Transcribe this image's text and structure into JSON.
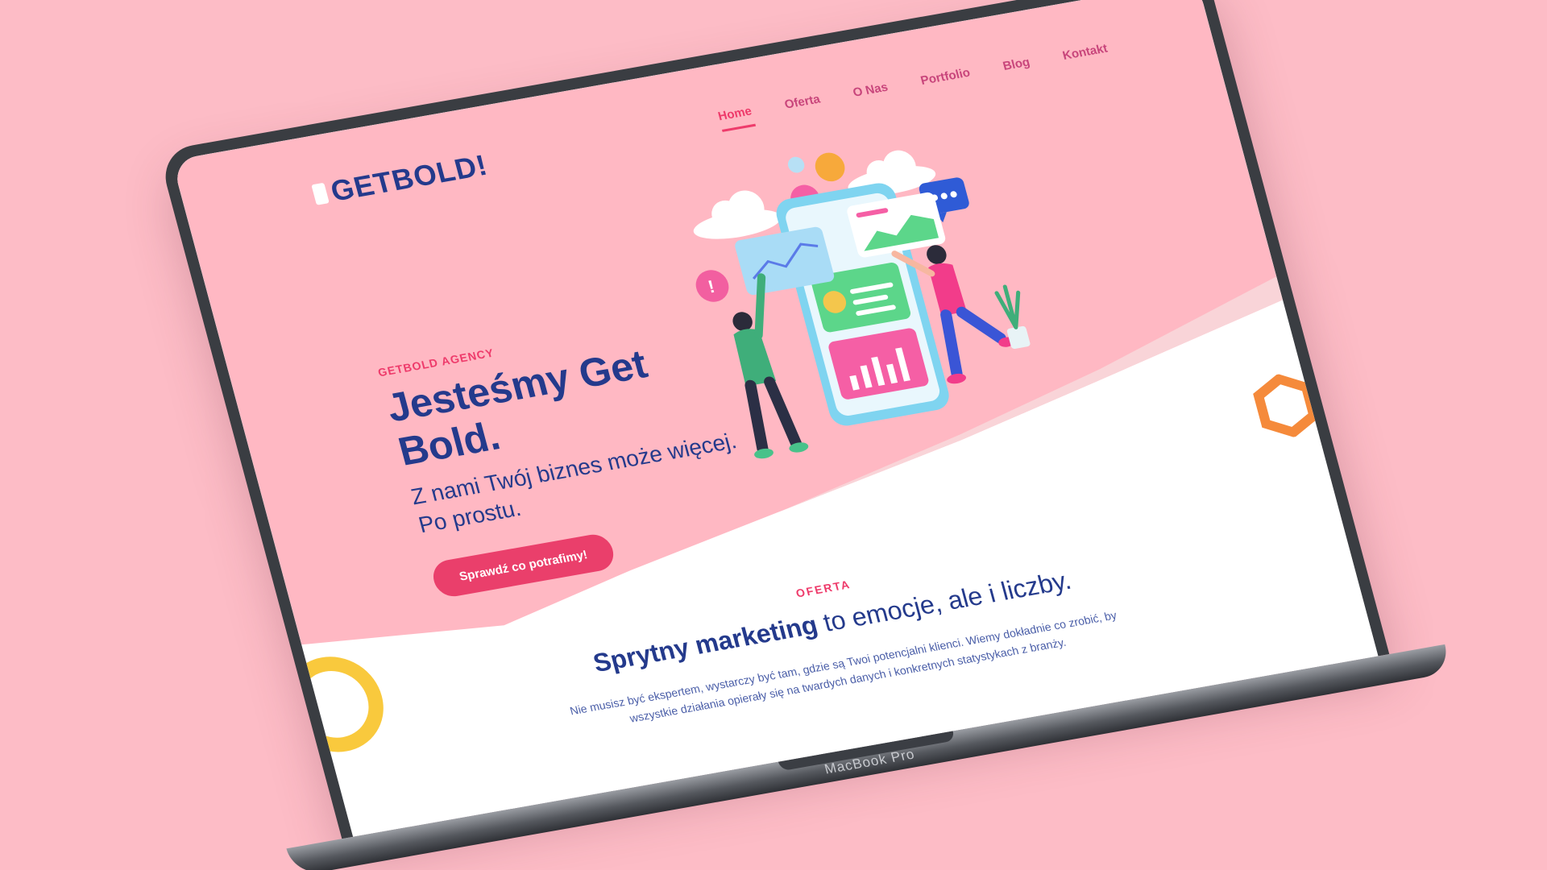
{
  "device": {
    "label": "MacBook Pro"
  },
  "site": {
    "logo": "GETBOLD!",
    "nav": [
      {
        "label": "Home",
        "active": true
      },
      {
        "label": "Oferta",
        "active": false
      },
      {
        "label": "O Nas",
        "active": false
      },
      {
        "label": "Portfolio",
        "active": false
      },
      {
        "label": "Blog",
        "active": false
      },
      {
        "label": "Kontakt",
        "active": false
      }
    ],
    "hero": {
      "eyebrow": "GETBOLD AGENCY",
      "title": "Jesteśmy Get Bold.",
      "subtitle": "Z nami Twój biznes może więcej. Po prostu.",
      "cta": "Sprawdź co potrafimy!"
    },
    "section": {
      "eyebrow": "OFERTA",
      "title_bold": "Sprytny marketing",
      "title_rest": " to emocje, ale i liczby.",
      "description": "Nie musisz być ekspertem, wystarczy być tam, gdzie są Twoi potencjalni klienci. Wiemy dokładnie co zrobić, by wszystkie działania opierały się na twardych danych i konkretnych statystykach z branży."
    }
  },
  "colors": {
    "background": "#fdbcc6",
    "hero_pink": "#ffb8c3",
    "accent": "#ee3b6b",
    "navy": "#243a8c",
    "yellow_ring": "#f9c93d",
    "orange_hex": "#f58a3b"
  },
  "icons": {
    "illustration": "marketing-dashboard-illustration",
    "deco_left": "yellow-ring-shape",
    "deco_right": "orange-hexagon-shape"
  }
}
